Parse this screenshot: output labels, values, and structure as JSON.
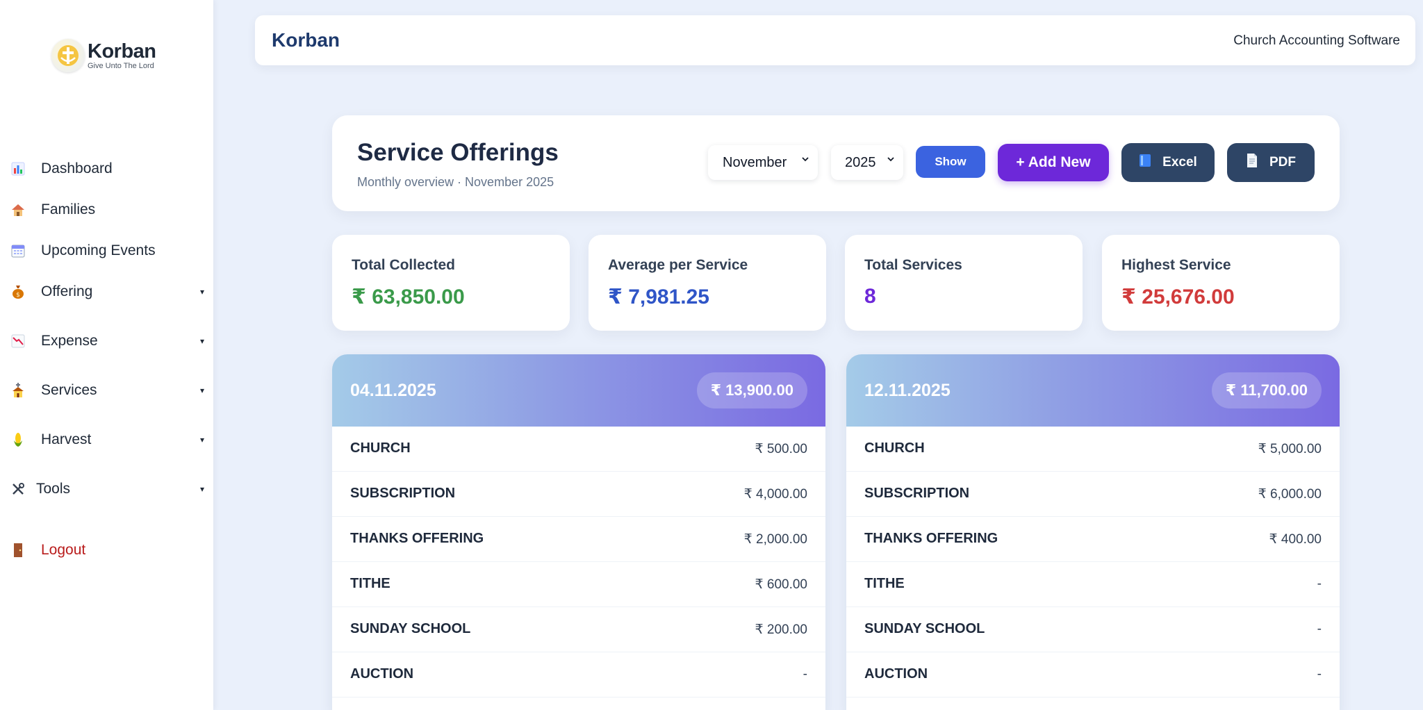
{
  "sidebar": {
    "logo_name": "Korban",
    "logo_tagline": "Give Unto The Lord",
    "items": [
      {
        "label": "Dashboard",
        "icon": "bar-chart-icon"
      },
      {
        "label": "Families",
        "icon": "house-icon"
      },
      {
        "label": "Upcoming Events",
        "icon": "calendar-icon"
      },
      {
        "label": "Offering",
        "icon": "money-bag-icon",
        "caret": "▾"
      },
      {
        "label": "Expense",
        "icon": "chart-decreasing-icon",
        "caret": "▾"
      },
      {
        "label": "Services",
        "icon": "church-icon",
        "caret": "▾"
      },
      {
        "label": "Harvest",
        "icon": "corn-icon",
        "caret": "▾"
      },
      {
        "label": "Tools",
        "icon": "tools-icon",
        "caret": "▾"
      },
      {
        "label": "Logout",
        "icon": "door-icon"
      }
    ]
  },
  "topbar": {
    "title": "Korban",
    "subtitle": "Church Accounting Software"
  },
  "header": {
    "title": "Service Offerings",
    "subtitle": "Monthly overview · November 2025",
    "month_value": "November",
    "year_value": "2025",
    "show_label": "Show",
    "add_label": "+ Add New",
    "excel_label": "Excel",
    "pdf_label": "PDF"
  },
  "stats": [
    {
      "label": "Total Collected",
      "value": "₹ 63,850.00",
      "color": "#3a9a4a"
    },
    {
      "label": "Average per Service",
      "value": "₹ 7,981.25",
      "color": "#2f55c7"
    },
    {
      "label": "Total Services",
      "value": "8",
      "color": "#6d28d9"
    },
    {
      "label": "Highest Service",
      "value": "₹ 25,676.00",
      "color": "#d13b3b"
    }
  ],
  "services": [
    {
      "date": "04.11.2025",
      "total": "₹ 13,900.00",
      "rows": [
        {
          "name": "CHURCH",
          "amount": "₹ 500.00"
        },
        {
          "name": "SUBSCRIPTION",
          "amount": "₹ 4,000.00"
        },
        {
          "name": "THANKS OFFERING",
          "amount": "₹ 2,000.00"
        },
        {
          "name": "TITHE",
          "amount": "₹ 600.00"
        },
        {
          "name": "SUNDAY SCHOOL",
          "amount": "₹ 200.00"
        },
        {
          "name": "AUCTION",
          "amount": "-"
        }
      ]
    },
    {
      "date": "12.11.2025",
      "total": "₹ 11,700.00",
      "rows": [
        {
          "name": "CHURCH",
          "amount": "₹ 5,000.00"
        },
        {
          "name": "SUBSCRIPTION",
          "amount": "₹ 6,000.00"
        },
        {
          "name": "THANKS OFFERING",
          "amount": "₹ 400.00"
        },
        {
          "name": "TITHE",
          "amount": "-"
        },
        {
          "name": "SUNDAY SCHOOL",
          "amount": "-"
        },
        {
          "name": "AUCTION",
          "amount": "-"
        }
      ]
    }
  ]
}
